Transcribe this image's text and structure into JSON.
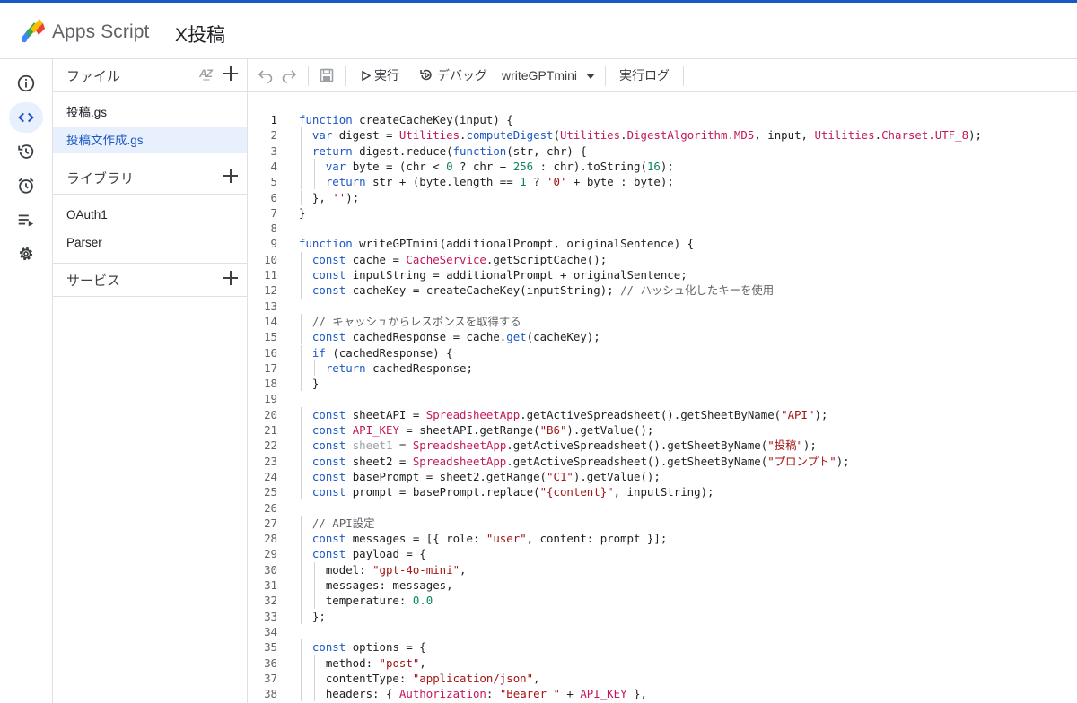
{
  "header": {
    "app_name": "Apps Script",
    "project_name": "X投稿"
  },
  "rail": {
    "items": [
      {
        "icon": "info-icon",
        "label": "Overview"
      },
      {
        "icon": "code-icon",
        "label": "Editor",
        "active": true
      },
      {
        "icon": "history-icon",
        "label": "History"
      },
      {
        "icon": "alarm-icon",
        "label": "Triggers"
      },
      {
        "icon": "executions-icon",
        "label": "Executions"
      },
      {
        "icon": "gear-icon",
        "label": "Settings"
      }
    ]
  },
  "sidebar": {
    "files_title": "ファイル",
    "files": [
      "投稿.gs",
      "投稿文作成.gs"
    ],
    "selected_file": "投稿文作成.gs",
    "libraries_title": "ライブラリ",
    "libraries": [
      "OAuth1",
      "Parser"
    ],
    "services_title": "サービス"
  },
  "toolbar": {
    "run_label": "実行",
    "debug_label": "デバッグ",
    "function_name": "writeGPTmini",
    "log_label": "実行ログ"
  },
  "code": {
    "current_line": 1,
    "lines": [
      [
        [
          "k",
          "function "
        ],
        [
          "f",
          "createCacheKey(input) {"
        ]
      ],
      [
        [
          "f",
          "  "
        ],
        [
          "k",
          "var "
        ],
        [
          "f",
          "digest = "
        ],
        [
          "g",
          "Utilities"
        ],
        [
          "f",
          "."
        ],
        [
          "k",
          "computeDigest"
        ],
        [
          "f",
          "("
        ],
        [
          "g",
          "Utilities"
        ],
        [
          "f",
          "."
        ],
        [
          "g",
          "DigestAlgorithm.MD5"
        ],
        [
          "f",
          ", input, "
        ],
        [
          "g",
          "Utilities"
        ],
        [
          "f",
          "."
        ],
        [
          "g",
          "Charset.UTF_8"
        ],
        [
          "f",
          ");"
        ]
      ],
      [
        [
          "f",
          "  "
        ],
        [
          "k",
          "return "
        ],
        [
          "f",
          "digest.reduce("
        ],
        [
          "k",
          "function"
        ],
        [
          "f",
          "(str, chr) {"
        ]
      ],
      [
        [
          "f",
          "    "
        ],
        [
          "k",
          "var "
        ],
        [
          "f",
          "byte = (chr < "
        ],
        [
          "n",
          "0"
        ],
        [
          "f",
          " ? chr + "
        ],
        [
          "n",
          "256"
        ],
        [
          "f",
          " : chr).toString("
        ],
        [
          "n",
          "16"
        ],
        [
          "f",
          ");"
        ]
      ],
      [
        [
          "f",
          "    "
        ],
        [
          "k",
          "return "
        ],
        [
          "f",
          "str + (byte.length == "
        ],
        [
          "n",
          "1"
        ],
        [
          "f",
          " ? "
        ],
        [
          "s",
          "'0'"
        ],
        [
          "f",
          " + byte : byte);"
        ]
      ],
      [
        [
          "f",
          "  }, "
        ],
        [
          "s",
          "''"
        ],
        [
          "f",
          ");"
        ]
      ],
      [
        [
          "f",
          "}"
        ]
      ],
      [],
      [
        [
          "k",
          "function "
        ],
        [
          "f",
          "writeGPTmini(additionalPrompt, originalSentence) {"
        ]
      ],
      [
        [
          "f",
          "  "
        ],
        [
          "k",
          "const "
        ],
        [
          "f",
          "cache = "
        ],
        [
          "g",
          "CacheService"
        ],
        [
          "f",
          ".getScriptCache();"
        ]
      ],
      [
        [
          "f",
          "  "
        ],
        [
          "k",
          "const "
        ],
        [
          "f",
          "inputString = additionalPrompt + originalSentence;"
        ]
      ],
      [
        [
          "f",
          "  "
        ],
        [
          "k",
          "const "
        ],
        [
          "f",
          "cacheKey = createCacheKey(inputString); "
        ],
        [
          "c",
          "// ハッシュ化したキーを使用"
        ]
      ],
      [],
      [
        [
          "c",
          "  // キャッシュからレスポンスを取得する"
        ]
      ],
      [
        [
          "f",
          "  "
        ],
        [
          "k",
          "const "
        ],
        [
          "f",
          "cachedResponse = cache."
        ],
        [
          "k",
          "get"
        ],
        [
          "f",
          "(cacheKey);"
        ]
      ],
      [
        [
          "f",
          "  "
        ],
        [
          "k",
          "if "
        ],
        [
          "f",
          "(cachedResponse) {"
        ]
      ],
      [
        [
          "f",
          "    "
        ],
        [
          "k",
          "return "
        ],
        [
          "f",
          "cachedResponse;"
        ]
      ],
      [
        [
          "f",
          "  }"
        ]
      ],
      [],
      [
        [
          "f",
          "  "
        ],
        [
          "k",
          "const "
        ],
        [
          "f",
          "sheetAPI = "
        ],
        [
          "g",
          "SpreadsheetApp"
        ],
        [
          "f",
          ".getActiveSpreadsheet().getSheetByName("
        ],
        [
          "s",
          "\"API\""
        ],
        [
          "f",
          ");"
        ]
      ],
      [
        [
          "f",
          "  "
        ],
        [
          "k",
          "const "
        ],
        [
          "g",
          "API_KEY"
        ],
        [
          "f",
          " = sheetAPI.getRange("
        ],
        [
          "s",
          "\"B6\""
        ],
        [
          "f",
          ").getValue();"
        ]
      ],
      [
        [
          "f",
          "  "
        ],
        [
          "k",
          "const "
        ],
        [
          "d",
          "sheet1"
        ],
        [
          "f",
          " = "
        ],
        [
          "g",
          "SpreadsheetApp"
        ],
        [
          "f",
          ".getActiveSpreadsheet().getSheetByName("
        ],
        [
          "s",
          "\"投稿\""
        ],
        [
          "f",
          ");"
        ]
      ],
      [
        [
          "f",
          "  "
        ],
        [
          "k",
          "const "
        ],
        [
          "f",
          "sheet2 = "
        ],
        [
          "g",
          "SpreadsheetApp"
        ],
        [
          "f",
          ".getActiveSpreadsheet().getSheetByName("
        ],
        [
          "s",
          "\"プロンプト\""
        ],
        [
          "f",
          ");"
        ]
      ],
      [
        [
          "f",
          "  "
        ],
        [
          "k",
          "const "
        ],
        [
          "f",
          "basePrompt = sheet2.getRange("
        ],
        [
          "s",
          "\"C1\""
        ],
        [
          "f",
          ").getValue();"
        ]
      ],
      [
        [
          "f",
          "  "
        ],
        [
          "k",
          "const "
        ],
        [
          "f",
          "prompt = basePrompt.replace("
        ],
        [
          "s",
          "\"{content}\""
        ],
        [
          "f",
          ", inputString);"
        ]
      ],
      [],
      [
        [
          "c",
          "  // API設定"
        ]
      ],
      [
        [
          "f",
          "  "
        ],
        [
          "k",
          "const "
        ],
        [
          "f",
          "messages = [{ role: "
        ],
        [
          "s",
          "\"user\""
        ],
        [
          "f",
          ", content: prompt }];"
        ]
      ],
      [
        [
          "f",
          "  "
        ],
        [
          "k",
          "const "
        ],
        [
          "f",
          "payload = {"
        ]
      ],
      [
        [
          "f",
          "    model: "
        ],
        [
          "s",
          "\"gpt-4o-mini\""
        ],
        [
          "f",
          ","
        ]
      ],
      [
        [
          "f",
          "    messages: messages,"
        ]
      ],
      [
        [
          "f",
          "    temperature: "
        ],
        [
          "n",
          "0.0"
        ]
      ],
      [
        [
          "f",
          "  };"
        ]
      ],
      [],
      [
        [
          "f",
          "  "
        ],
        [
          "k",
          "const "
        ],
        [
          "f",
          "options = {"
        ]
      ],
      [
        [
          "f",
          "    method: "
        ],
        [
          "s",
          "\"post\""
        ],
        [
          "f",
          ","
        ]
      ],
      [
        [
          "f",
          "    contentType: "
        ],
        [
          "s",
          "\"application/json\""
        ],
        [
          "f",
          ","
        ]
      ],
      [
        [
          "f",
          "    headers: { "
        ],
        [
          "g",
          "Authorization"
        ],
        [
          "f",
          ": "
        ],
        [
          "s",
          "\"Bearer \""
        ],
        [
          "f",
          " + "
        ],
        [
          "g",
          "API_KEY"
        ],
        [
          "f",
          " },"
        ]
      ]
    ]
  }
}
